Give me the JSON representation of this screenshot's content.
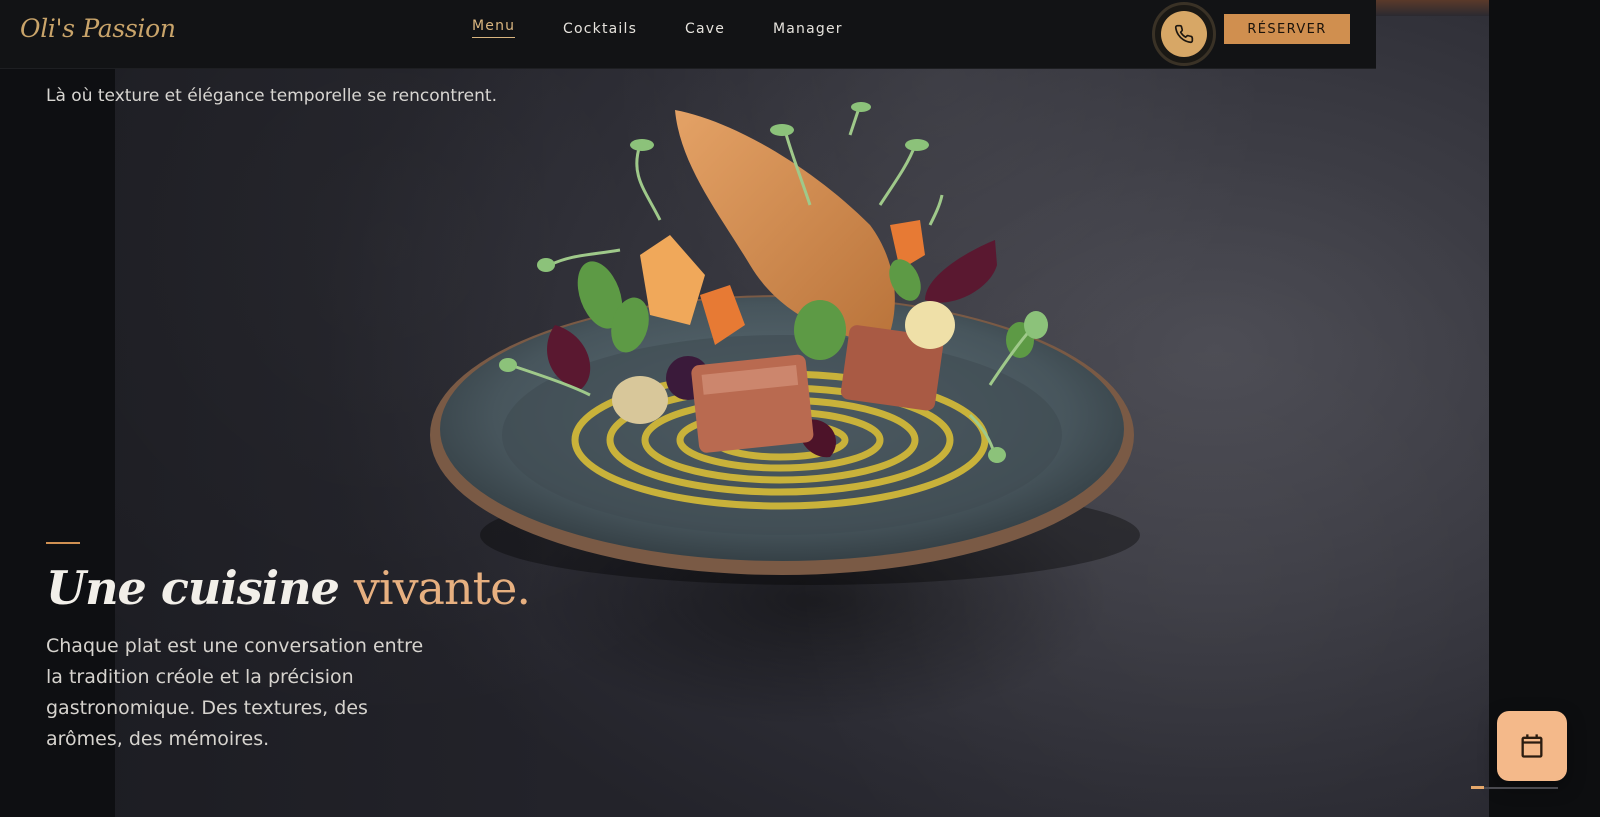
{
  "brand": {
    "logo": "Oli's Passion",
    "accent": "#d08f4f",
    "gold": "#c9a46a"
  },
  "nav": {
    "items": [
      {
        "label": "Menu",
        "active": true
      },
      {
        "label": "Cocktails",
        "active": false
      },
      {
        "label": "Cave",
        "active": false
      },
      {
        "label": "Manager",
        "active": false
      }
    ],
    "phone_icon": "phone-icon",
    "reserve_label": "RÉSERVER"
  },
  "hero": {
    "subtitle": "Là où texture et élégance temporelle se rencontrent.",
    "headline_white": "Une cuisine",
    "headline_accent": "vivante.",
    "body": "Chaque plat est une conversation entre la tradition créole et la précision gastronomique. Des textures, des arômes, des mémoires."
  },
  "floating": {
    "icon": "calendar-icon"
  },
  "slider": {
    "progress": 0.15
  }
}
